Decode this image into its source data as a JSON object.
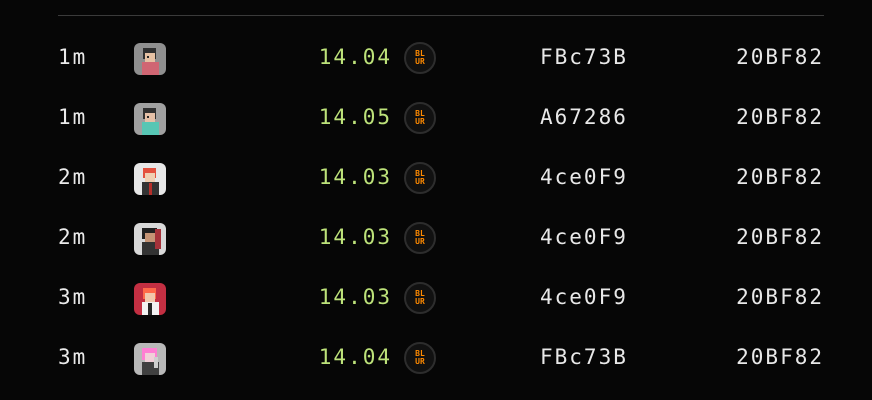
{
  "rows": [
    {
      "time": "1m",
      "avatar": "pixel-character-avatar-1",
      "avatar_bg": "#8f8f8f",
      "price": "14.04",
      "token_text": [
        "BL",
        "UR"
      ],
      "from": "FBc73B",
      "to": "20BF82"
    },
    {
      "time": "1m",
      "avatar": "pixel-character-avatar-2",
      "avatar_bg": "#a0a0a0",
      "price": "14.05",
      "token_text": [
        "BL",
        "UR"
      ],
      "from": "A67286",
      "to": "20BF82"
    },
    {
      "time": "2m",
      "avatar": "pixel-character-avatar-3",
      "avatar_bg": "#e7e7e7",
      "price": "14.03",
      "token_text": [
        "BL",
        "UR"
      ],
      "from": "4ce0F9",
      "to": "20BF82"
    },
    {
      "time": "2m",
      "avatar": "pixel-character-avatar-4",
      "avatar_bg": "#d8d8d8",
      "price": "14.03",
      "token_text": [
        "BL",
        "UR"
      ],
      "from": "4ce0F9",
      "to": "20BF82"
    },
    {
      "time": "3m",
      "avatar": "pixel-character-avatar-5",
      "avatar_bg": "#c32f42",
      "price": "14.03",
      "token_text": [
        "BL",
        "UR"
      ],
      "from": "4ce0F9",
      "to": "20BF82"
    },
    {
      "time": "3m",
      "avatar": "pixel-character-avatar-6",
      "avatar_bg": "#b8b8b8",
      "price": "14.04",
      "token_text": [
        "BL",
        "UR"
      ],
      "from": "FBc73B",
      "to": "20BF82"
    }
  ],
  "colors": {
    "background": "#060606",
    "price": "#bde27a",
    "token_orange": "#ff8a00",
    "divider": "#3a3a3a"
  }
}
